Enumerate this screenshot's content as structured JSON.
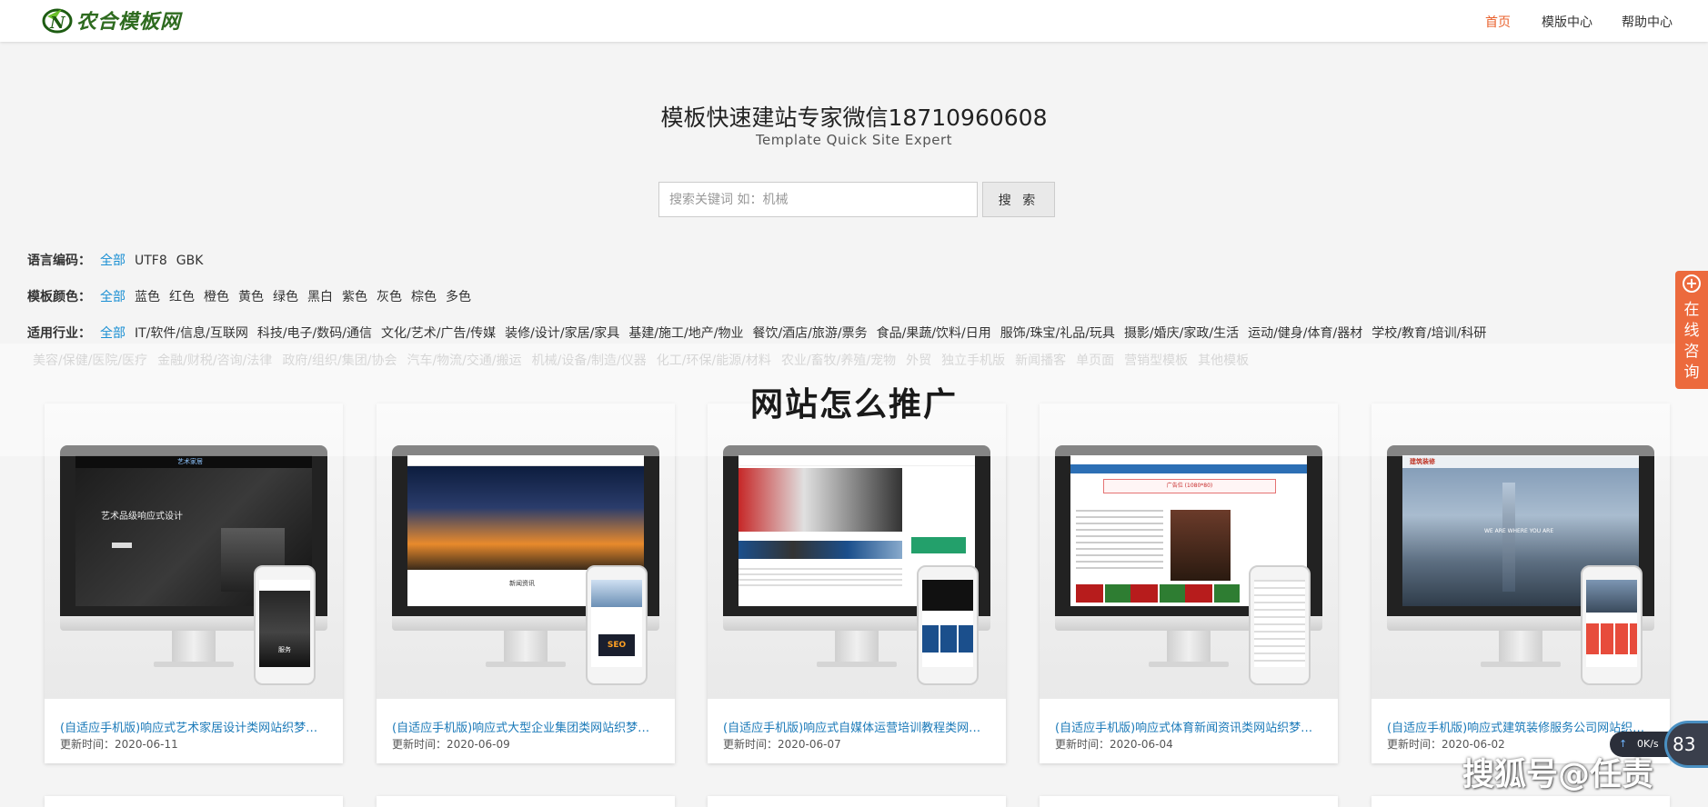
{
  "header": {
    "logo_text": "农合模板网",
    "nav": [
      {
        "label": "首页",
        "active": true
      },
      {
        "label": "模版中心",
        "active": false
      },
      {
        "label": "帮助中心",
        "active": false
      }
    ]
  },
  "hero": {
    "title": "模板快速建站专家微信18710960608",
    "subtitle": "Template Quick Site Expert"
  },
  "search": {
    "placeholder": "搜索关键词 如：机械",
    "button_label": "搜 索"
  },
  "filters": {
    "language": {
      "label": "语言编码：",
      "options": [
        "全部",
        "UTF8",
        "GBK"
      ]
    },
    "color": {
      "label": "模板颜色：",
      "options": [
        "全部",
        "蓝色",
        "红色",
        "橙色",
        "黄色",
        "绿色",
        "黑白",
        "紫色",
        "灰色",
        "棕色",
        "多色"
      ]
    },
    "industry": {
      "label": "适用行业：",
      "options": [
        "全部",
        "IT/软件/信息/互联网",
        "科技/电子/数码/通信",
        "文化/艺术/广告/传媒",
        "装修/设计/家居/家具",
        "基建/施工/地产/物业",
        "餐饮/酒店/旅游/票务",
        "食品/果蔬/饮料/日用",
        "服饰/珠宝/礼品/玩具",
        "摄影/婚庆/家政/生活",
        "运动/健身/体育/器材",
        "学校/教育/培训/科研"
      ],
      "options_row2": [
        "美容/保健/医院/医疗",
        "金融/财税/咨询/法律",
        "政府/组织/集团/协会",
        "汽车/物流/交通/搬运",
        "机械/设备/制造/仪器",
        "化工/环保/能源/材料",
        "农业/畜牧/养殖/宠物",
        "外贸",
        "独立手机版",
        "新闻播客",
        "单页面",
        "营销型模板",
        "其他模板"
      ]
    }
  },
  "overlay_title": "网站怎么推广",
  "cards": [
    {
      "title": "(自适应手机版)响应式艺术家居设计类网站织梦模板 H...",
      "date": "更新时间：2020-06-11",
      "screen_text": "艺术品级响应式设计",
      "brand": "艺术家居",
      "phone_text": "服务"
    },
    {
      "title": "(自适应手机版)响应式大型企业集团类网站织梦模板 H...",
      "date": "更新时间：2020-06-09",
      "screen_text": "新闻资讯",
      "brand": "",
      "phone_text": "SEO"
    },
    {
      "title": "(自适应手机版)响应式自媒体运营培训教程类网站织梦...",
      "date": "更新时间：2020-06-07",
      "screen_text": "",
      "brand": "",
      "phone_text": ""
    },
    {
      "title": "(自适应手机版)响应式体育新闻资讯类网站织梦模板 H...",
      "date": "更新时间：2020-06-04",
      "screen_text": "广告位 (1080*80)",
      "brand": "",
      "phone_text": ""
    },
    {
      "title": "(自适应手机版)响应式建筑装修服务公司网站织梦模板...",
      "date": "更新时间：2020-06-02",
      "screen_text": "WE ARE WHERE YOU ARE",
      "brand": "建筑装修",
      "phone_text": ""
    }
  ],
  "consult_tab": {
    "icon": "plus-icon",
    "label": "在线咨询"
  },
  "speed_widget": {
    "rate": "0K/s",
    "percent": "83"
  },
  "watermark": "搜狐号@任责",
  "colors": {
    "accent": "#e9612d",
    "link": "#1a8fd3",
    "card_title": "#1a79b8",
    "consult": "#ec6a3d"
  }
}
